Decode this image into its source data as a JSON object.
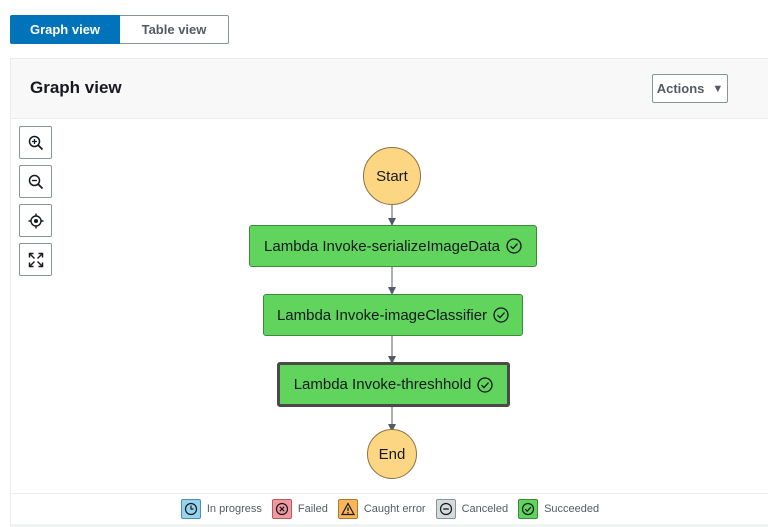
{
  "tabs": {
    "graph_label": "Graph view",
    "table_label": "Table view"
  },
  "panel": {
    "title": "Graph view",
    "actions_label": "Actions",
    "actions_caret": "▼"
  },
  "tools": [
    "zoom-in",
    "zoom-out",
    "center",
    "fit"
  ],
  "graph": {
    "start_label": "Start",
    "end_label": "End",
    "states": [
      {
        "label": "Lambda Invoke-serializeImageData",
        "status": "Succeeded"
      },
      {
        "label": "Lambda Invoke-imageClassifier",
        "status": "Succeeded"
      },
      {
        "label": "Lambda Invoke-threshhold",
        "status": "Succeeded",
        "selected": true
      }
    ]
  },
  "legend": [
    {
      "label": "In progress",
      "color": "#98d3ee"
    },
    {
      "label": "Failed",
      "color": "#f09aa0"
    },
    {
      "label": "Caught error",
      "color": "#f8b55b"
    },
    {
      "label": "Canceled",
      "color": "#d5dbdb"
    },
    {
      "label": "Succeeded",
      "color": "#60d45c"
    }
  ],
  "colors": {
    "accent": "#0073bb",
    "success_node": "#60d45c",
    "terminal_node": "#fdd684"
  }
}
